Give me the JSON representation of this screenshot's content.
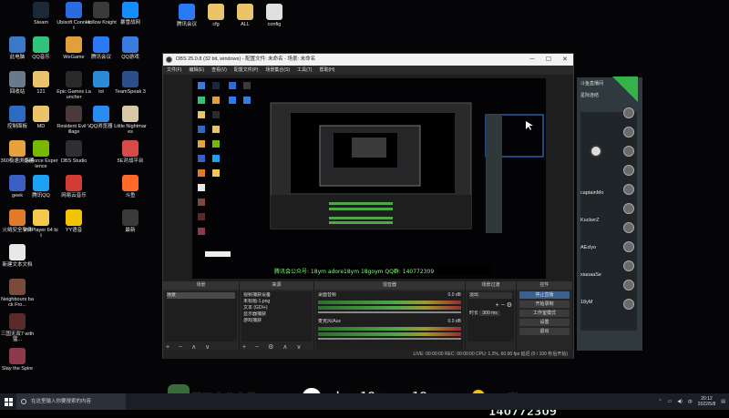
{
  "desktop": {
    "icons_col1": [
      {
        "label": "此电脑",
        "color": "#3a78c9"
      },
      {
        "label": "回收站",
        "color": "#6a7a8a"
      },
      {
        "label": "控制面板",
        "color": "#2c6bbf"
      },
      {
        "label": "360极速浏览器",
        "color": "#e6a23c"
      },
      {
        "label": "geek",
        "color": "#3a5ec2"
      },
      {
        "label": "火绒安全软件",
        "color": "#e07b2c"
      },
      {
        "label": "新建文本文档",
        "color": "#e8e8e8"
      },
      {
        "label": "Neighbours back Fro...",
        "color": "#7a4a3a"
      },
      {
        "label": "三国无双7 with 猛...",
        "color": "#5a2a2a"
      },
      {
        "label": "Slay the Spire",
        "color": "#8a3a4a"
      }
    ],
    "icons_col2": [
      {
        "label": "Steam",
        "color": "#1b2838"
      },
      {
        "label": "QQ音乐",
        "color": "#31c27c"
      },
      {
        "label": "121",
        "color": "#e9c46a"
      },
      {
        "label": "MD",
        "color": "#e9c46a"
      },
      {
        "label": "GeForce Experience",
        "color": "#76b900"
      },
      {
        "label": "腾讯QQ",
        "color": "#1da1f2"
      },
      {
        "label": "PotPlayer 64 bit",
        "color": "#f2c94c"
      }
    ],
    "icons_col3": [
      {
        "label": "Ubisoft Connect",
        "color": "#2b6be0"
      },
      {
        "label": "WeGame",
        "color": "#e0a13b"
      },
      {
        "label": "Epic Games Launcher",
        "color": "#2a2a2a"
      },
      {
        "label": "Resident Evil Village",
        "color": "#4a3a3a"
      },
      {
        "label": "OBS Studio",
        "color": "#302e31"
      },
      {
        "label": "网易云音乐",
        "color": "#d43c33"
      },
      {
        "label": "YY语音",
        "color": "#f2c400"
      }
    ],
    "icons_col4": [
      {
        "label": "Hollow Knight",
        "color": "#3a3a3a"
      },
      {
        "label": "腾讯会议",
        "color": "#2a7af5"
      },
      {
        "label": "lol",
        "color": "#2d8ad6"
      },
      {
        "label": "QQ浏览器",
        "color": "#2a8cf0"
      }
    ],
    "icons_col5": [
      {
        "label": "暴雪战网",
        "color": "#148eff"
      },
      {
        "label": "QQ游戏",
        "color": "#3a7be0"
      },
      {
        "label": "TeamSpeak 3",
        "color": "#2c4e8a"
      },
      {
        "label": "Little Nightmares",
        "color": "#d8c8a8"
      },
      {
        "label": "5E对战平台",
        "color": "#d64a4a"
      },
      {
        "label": "斗鱼",
        "color": "#ff6a2a"
      },
      {
        "label": "最新",
        "color": "#3a3a3a"
      }
    ],
    "icons_top": [
      {
        "label": "腾讯会议",
        "color": "#2a7af5"
      },
      {
        "label": "cfg",
        "color": "#e9c46a"
      },
      {
        "label": "ALL",
        "color": "#e9c46a"
      },
      {
        "label": "config",
        "color": "#e0e0e0"
      }
    ]
  },
  "obs": {
    "title": "OBS 25.0.8 (32 bit, windows) - 配置文件: 未命名 - 场景: 未命名",
    "menu": [
      "文件(F)",
      "编辑(E)",
      "查看(V)",
      "配置文件(P)",
      "场景集合(S)",
      "工具(T)",
      "帮助(H)"
    ],
    "docks": {
      "scenes": {
        "title": "场景",
        "items": [
          "场景"
        ]
      },
      "sources": {
        "title": "来源",
        "items": [
          "视频捕获设备",
          "未标题-1.png",
          "文本 (GDI+)",
          "显示器捕获",
          "游戏捕获"
        ]
      },
      "mixer": {
        "title": "混音器",
        "channels": [
          {
            "name": "桌面音频",
            "db": "0.0 dB"
          },
          {
            "name": "麦克风/Aux",
            "db": "0.0 dB"
          }
        ]
      },
      "transitions": {
        "title": "场景过渡",
        "mode": "淡出",
        "duration_label": "时长",
        "duration": "300 ms"
      },
      "controls": {
        "title": "控件",
        "buttons": [
          "停止直播",
          "开始录制",
          "工作室模式",
          "设置",
          "退出"
        ]
      }
    },
    "status": "LIVE: 00:00:00   REC: 00:00:00   CPU: 1.2%, 60.00 fps   延迟 (0 / 100 秒后开始)"
  },
  "side_panel": {
    "header": "斗鱼直播间",
    "sub": "星际连结",
    "viewers": [
      "captainMo",
      "KuckerZ",
      "AEzlyo",
      "xiaoaaSe",
      "18yM"
    ]
  },
  "banner": {
    "bili": "腾讯会公众号: 18ym",
    "wechat": "adore18ym",
    "douyin": "18goym",
    "qq": "QQ群: 140772309"
  },
  "taskbar": {
    "search_placeholder": "在这里输入你要搜索的内容",
    "time": "20:12",
    "date": "2022/5/8"
  }
}
